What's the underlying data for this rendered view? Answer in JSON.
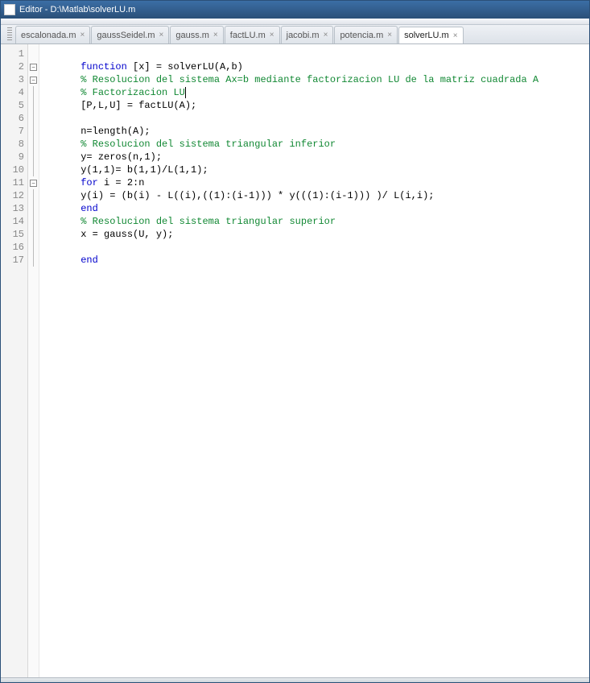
{
  "window": {
    "title": "Editor - D:\\Matlab\\solverLU.m"
  },
  "tabs": [
    {
      "label": "escalonada.m",
      "active": false
    },
    {
      "label": "gaussSeidel.m",
      "active": false
    },
    {
      "label": "gauss.m",
      "active": false
    },
    {
      "label": "factLU.m",
      "active": false
    },
    {
      "label": "jacobi.m",
      "active": false
    },
    {
      "label": "potencia.m",
      "active": false
    },
    {
      "label": "solverLU.m",
      "active": true
    }
  ],
  "code": {
    "lines": [
      {
        "n": 1,
        "fold": "",
        "tokens": []
      },
      {
        "n": 2,
        "fold": "box-",
        "tokens": [
          {
            "t": "function",
            "c": "kw"
          },
          {
            "t": " [x] = solverLU(A,b)",
            "c": ""
          }
        ]
      },
      {
        "n": 3,
        "fold": "box-",
        "tokens": [
          {
            "t": "% Resolucion del sistema Ax=b mediante factorizacion LU de la matriz cuadrada A",
            "c": "cm"
          }
        ]
      },
      {
        "n": 4,
        "fold": "line",
        "tokens": [
          {
            "t": "% Factorizacion LU",
            "c": "cm"
          },
          {
            "t": "|",
            "c": "cursor"
          }
        ]
      },
      {
        "n": 5,
        "fold": "line",
        "tokens": [
          {
            "t": "[P,L,U] = factLU(A);",
            "c": ""
          }
        ]
      },
      {
        "n": 6,
        "fold": "line",
        "tokens": []
      },
      {
        "n": 7,
        "fold": "line",
        "tokens": [
          {
            "t": "n=length(A);",
            "c": ""
          }
        ]
      },
      {
        "n": 8,
        "fold": "line",
        "tokens": [
          {
            "t": "% Resolucion del sistema triangular inferior",
            "c": "cm"
          }
        ]
      },
      {
        "n": 9,
        "fold": "line",
        "tokens": [
          {
            "t": "y= zeros(n,1);",
            "c": ""
          }
        ]
      },
      {
        "n": 10,
        "fold": "line",
        "tokens": [
          {
            "t": "y(1,1)= b(1,1)/L(1,1);",
            "c": ""
          }
        ]
      },
      {
        "n": 11,
        "fold": "box",
        "tokens": [
          {
            "t": "for",
            "c": "kw"
          },
          {
            "t": " i = 2:n",
            "c": ""
          }
        ]
      },
      {
        "n": 12,
        "fold": "line",
        "tokens": [
          {
            "t": "y(i) = (b(i) - L((i),((1):(i-1))) * y(((1):(i-1))) )/ L(i,i);",
            "c": ""
          }
        ]
      },
      {
        "n": 13,
        "fold": "line",
        "tokens": [
          {
            "t": "end",
            "c": "kw"
          }
        ]
      },
      {
        "n": 14,
        "fold": "line",
        "tokens": [
          {
            "t": "% Resolucion del sistema triangular superior",
            "c": "cm"
          }
        ]
      },
      {
        "n": 15,
        "fold": "line",
        "tokens": [
          {
            "t": "x = gauss(U, y);",
            "c": ""
          }
        ]
      },
      {
        "n": 16,
        "fold": "line",
        "tokens": []
      },
      {
        "n": 17,
        "fold": "line",
        "tokens": [
          {
            "t": "end",
            "c": "kw"
          }
        ]
      }
    ]
  }
}
